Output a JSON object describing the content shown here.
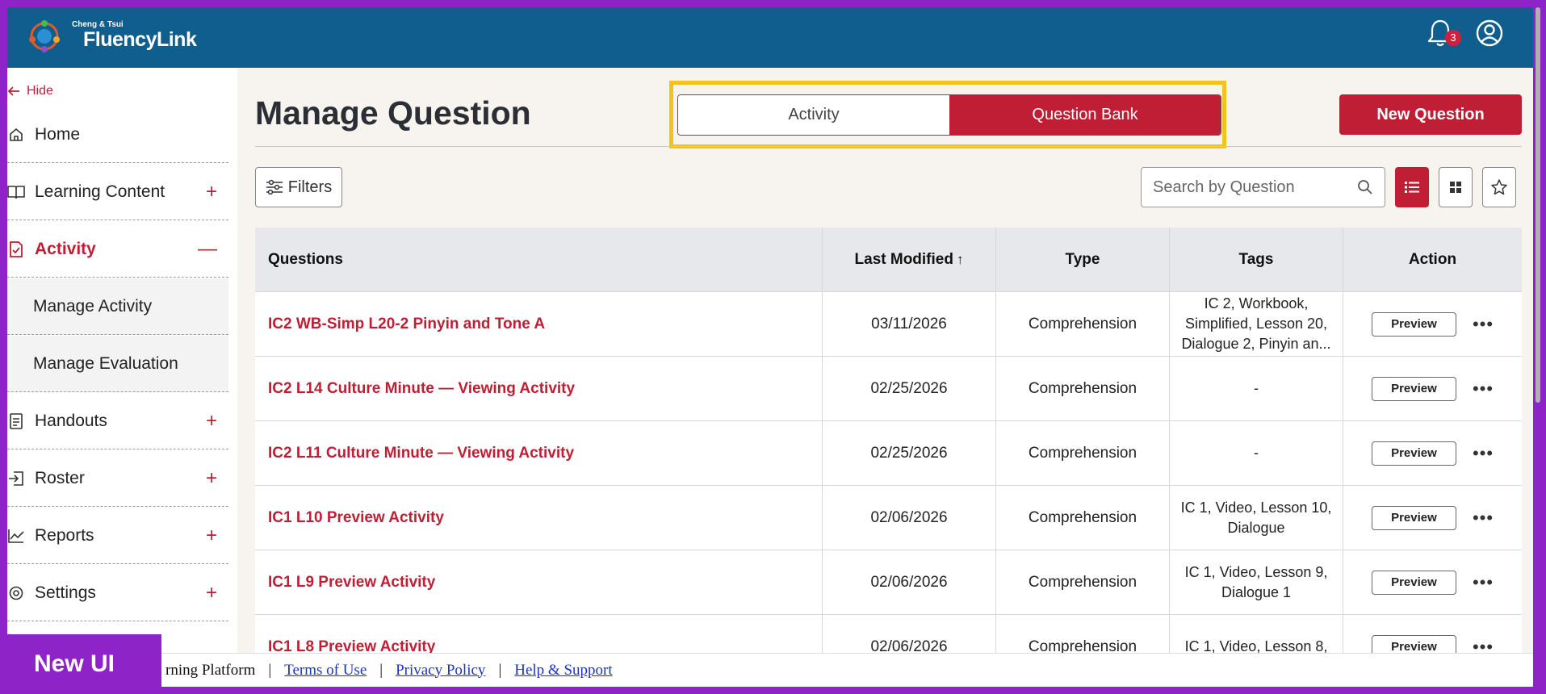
{
  "header": {
    "logo_small": "Cheng & Tsui",
    "logo_main": "FluencyLink",
    "notification_count": "3"
  },
  "sidebar": {
    "hide_label": "Hide",
    "items": [
      {
        "label": "Home",
        "icon": "home-icon"
      },
      {
        "label": "Learning Content",
        "icon": "book-icon"
      },
      {
        "label": "Activity",
        "icon": "activity-icon"
      },
      {
        "label": "Handouts",
        "icon": "document-icon"
      },
      {
        "label": "Roster",
        "icon": "roster-icon"
      },
      {
        "label": "Reports",
        "icon": "chart-icon"
      },
      {
        "label": "Settings",
        "icon": "settings-icon"
      }
    ],
    "subitems": [
      "Manage Activity",
      "Manage Evaluation"
    ]
  },
  "main": {
    "title": "Manage Question",
    "toggle": {
      "activity": "Activity",
      "question_bank": "Question Bank"
    },
    "new_button": "New Question",
    "filters_label": "Filters",
    "search_placeholder": "Search by Question"
  },
  "table": {
    "headers": {
      "questions": "Questions",
      "last_modified": "Last Modified",
      "sort_arrow": "↑",
      "type": "Type",
      "tags": "Tags",
      "action": "Action"
    },
    "preview_label": "Preview",
    "more_label": "•••",
    "rows": [
      {
        "question": "IC2 WB-Simp L20-2 Pinyin and Tone A",
        "date": "03/11/2026",
        "type": "Comprehension",
        "tags": "IC 2, Workbook, Simplified, Lesson 20, Dialogue 2, Pinyin an..."
      },
      {
        "question": "IC2 L14 Culture Minute — Viewing Activity",
        "date": "02/25/2026",
        "type": "Comprehension",
        "tags": "-"
      },
      {
        "question": "IC2 L11 Culture Minute — Viewing Activity",
        "date": "02/25/2026",
        "type": "Comprehension",
        "tags": "-"
      },
      {
        "question": "IC1 L10 Preview Activity",
        "date": "02/06/2026",
        "type": "Comprehension",
        "tags": "IC 1, Video, Lesson 10, Dialogue"
      },
      {
        "question": "IC1 L9 Preview Activity",
        "date": "02/06/2026",
        "type": "Comprehension",
        "tags": "IC 1, Video, Lesson 9, Dialogue 1"
      },
      {
        "question": "IC1 L8 Preview Activity",
        "date": "02/06/2026",
        "type": "Comprehension",
        "tags": "IC 1, Video, Lesson 8,"
      }
    ]
  },
  "footer": {
    "platform_text": "rning Platform",
    "separator": "|",
    "terms": "Terms of Use",
    "privacy": "Privacy Policy",
    "help": "Help & Support"
  },
  "overlay_badge": "New UI",
  "colors": {
    "header_bg": "#0f5e8d",
    "accent": "#c01e35",
    "highlight": "#f4c21f",
    "border_frame": "#8e24c7"
  }
}
